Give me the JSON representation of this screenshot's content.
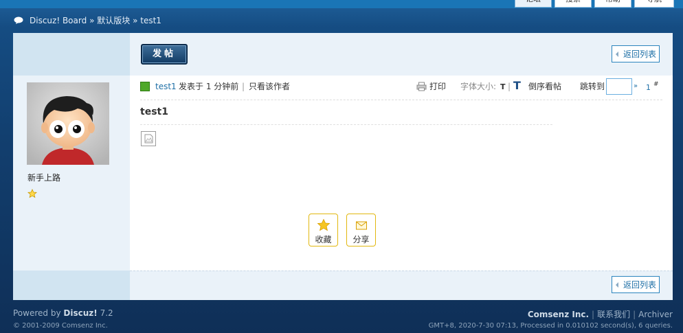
{
  "nav": {
    "tabs": [
      {
        "label": "论坛",
        "active": true
      },
      {
        "label": "搜索",
        "active": false
      },
      {
        "label": "帮助",
        "active": false
      },
      {
        "label": "导航",
        "active": false
      }
    ]
  },
  "breadcrumb": {
    "forum": "Discuz! Board",
    "sep1": "»",
    "board": "默认版块",
    "sep2": "»",
    "thread": "test1"
  },
  "toolbar": {
    "post_label": "发帖",
    "back_label": "返回列表"
  },
  "author": {
    "rank": "新手上路",
    "name": "test1"
  },
  "post": {
    "posted": "发表于 1 分钟前",
    "sep": "|",
    "only_author": "只看该作者",
    "print": "打印",
    "font_size_label": "字体大小:",
    "font_small": "T",
    "font_sep": "|",
    "font_large": "T",
    "reverse": "倒序看帖",
    "jump_label": "跳转到",
    "jump_go": "»",
    "floor": "1",
    "floor_mark": "#",
    "title": "test1"
  },
  "actions": {
    "favorite": "收藏",
    "share": "分享"
  },
  "footer": {
    "powered_prefix": "Powered by",
    "powered_name": "Discuz!",
    "powered_version": "7.2",
    "copyright": "© 2001-2009 Comsenz Inc.",
    "company": "Comsenz Inc.",
    "sep": "|",
    "contact": "联系我们",
    "archiver": "Archiver",
    "stats": "GMT+8, 2020-7-30 07:13, Processed in 0.010102 second(s), 6 queries."
  },
  "colors": {
    "link": "#1e6fa6",
    "accent_border": "#e1b70e",
    "sidebar_bg": "#eaf2f9"
  }
}
